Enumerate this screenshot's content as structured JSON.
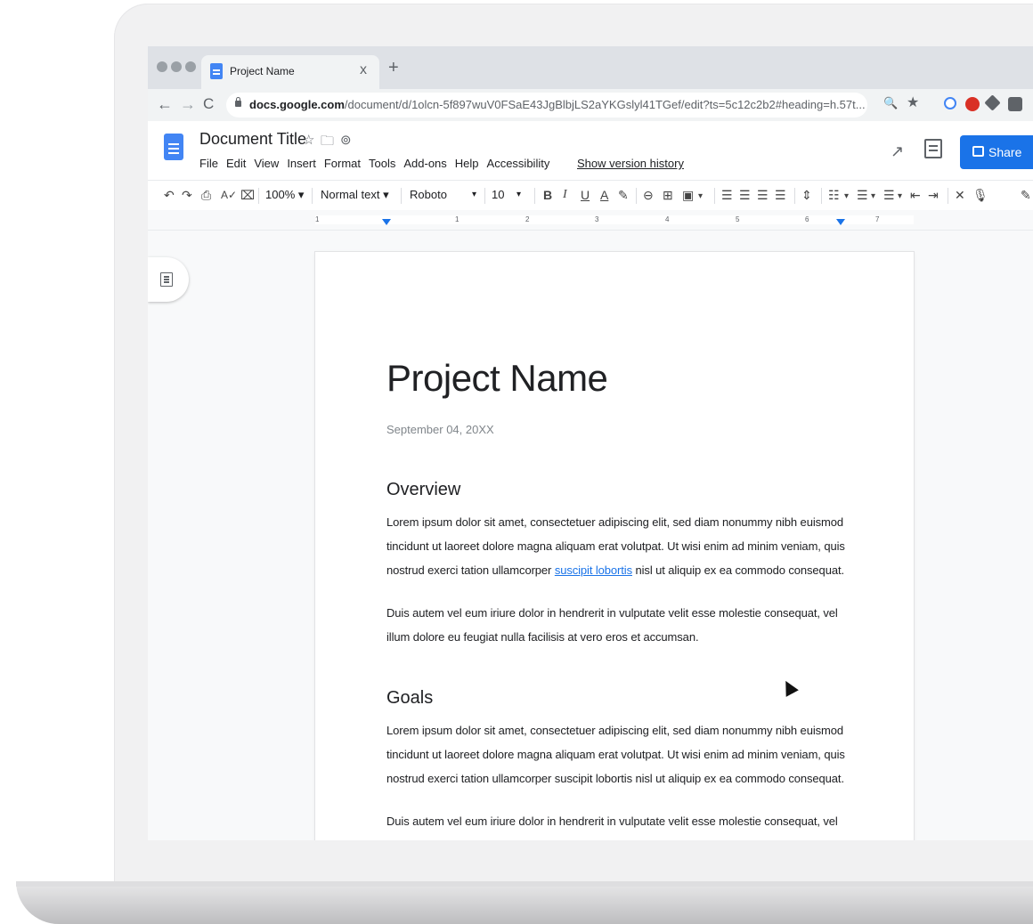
{
  "browser": {
    "tab_title": "Project Name",
    "tab_close": "x",
    "new_tab": "+",
    "url_domain": "docs.google.com",
    "url_path": "/document/d/1olcn-5f897wuV0FSaE43JgBlbjLS2aYKGslyl41TGef/edit?ts=5c12c2b2#heading=h.57t...",
    "nav_back": "←",
    "nav_forward": "→",
    "nav_reload": "C",
    "zoom_icon": "🔍",
    "bookmark_star": "★"
  },
  "docs_header": {
    "title": "Document Title",
    "star_icon": "☆",
    "folder_icon": "🗀",
    "cloud_icon": "⊚",
    "menu": [
      "File",
      "Edit",
      "View",
      "Insert",
      "Format",
      "Tools",
      "Add-ons",
      "Help",
      "Accessibility"
    ],
    "version_history": "Show version history",
    "share_label": "Share"
  },
  "toolbar": {
    "zoom": "100%",
    "style": "Normal text",
    "font": "Roboto",
    "size": "10",
    "bold": "B",
    "italic": "I",
    "underline": "U",
    "text_color": "A"
  },
  "ruler": {
    "numbers": [
      "1",
      "1",
      "2",
      "3",
      "4",
      "5",
      "6",
      "7"
    ]
  },
  "document": {
    "title": "Project Name",
    "date": "September 04, 20XX",
    "overview_heading": "Overview",
    "overview_p1_a": "Lorem ipsum dolor sit amet, consectetuer adipiscing elit, sed diam nonummy nibh euismod tincidunt ut laoreet dolore magna aliquam erat volutpat. Ut wisi enim ad minim veniam, quis nostrud exerci tation ullamcorper ",
    "overview_p1_link": "suscipit lobortis",
    "overview_p1_b": " nisl ut aliquip ex ea commodo consequat.",
    "overview_p2": "Duis autem vel eum iriure dolor in hendrerit in vulputate velit esse molestie consequat, vel illum dolore eu feugiat nulla facilisis at vero eros et accumsan.",
    "goals_heading": "Goals",
    "goals_p1": "Lorem ipsum dolor sit amet, consectetuer adipiscing elit, sed diam nonummy nibh euismod tincidunt ut laoreet dolore magna aliquam erat volutpat. Ut wisi enim ad minim veniam, quis nostrud exerci tation ullamcorper suscipit lobortis nisl ut aliquip ex ea commodo consequat.",
    "goals_p2": "Duis autem vel eum iriure dolor in hendrerit in vulputate velit esse molestie consequat, vel illum dolore eu feugiat nulla facilisis at vero eros et accumsan."
  },
  "colors": {
    "docs_blue": "#4285f4",
    "share_blue": "#1a73e8",
    "link_blue": "#1a73e8"
  }
}
